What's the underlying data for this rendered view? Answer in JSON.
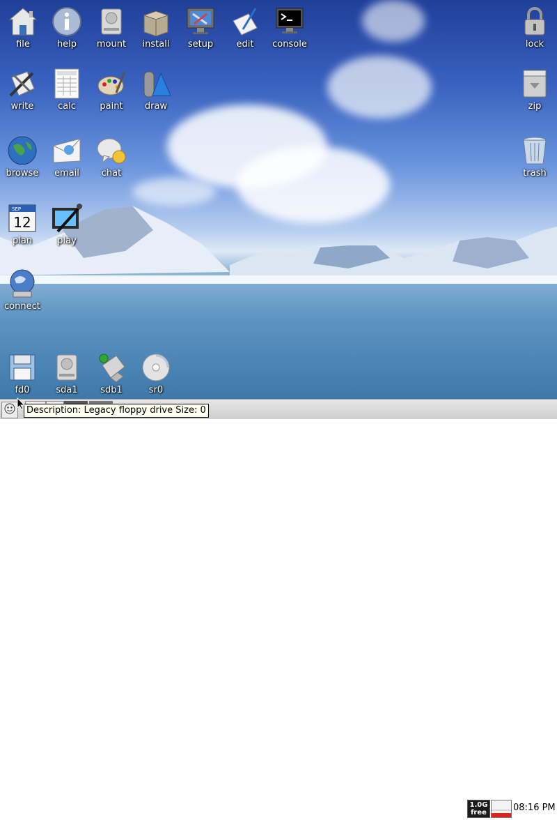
{
  "desktop_icons_left": [
    {
      "name": "file-icon",
      "label": "file"
    },
    {
      "name": "help-icon",
      "label": "help"
    },
    {
      "name": "mount-icon",
      "label": "mount"
    },
    {
      "name": "install-icon",
      "label": "install"
    },
    {
      "name": "setup-icon",
      "label": "setup"
    },
    {
      "name": "edit-icon",
      "label": "edit"
    },
    {
      "name": "console-icon",
      "label": "console"
    },
    {
      "name": "write-icon",
      "label": "write"
    },
    {
      "name": "calc-icon",
      "label": "calc"
    },
    {
      "name": "paint-icon",
      "label": "paint"
    },
    {
      "name": "draw-icon",
      "label": "draw"
    },
    {
      "name": "browse-icon",
      "label": "browse"
    },
    {
      "name": "email-icon",
      "label": "email"
    },
    {
      "name": "chat-icon",
      "label": "chat"
    },
    {
      "name": "plan-icon",
      "label": "plan",
      "calendar_month": "SEP",
      "calendar_day": "12"
    },
    {
      "name": "play-icon",
      "label": "play"
    },
    {
      "name": "connect-icon",
      "label": "connect"
    }
  ],
  "desktop_icons_right": [
    {
      "name": "lock-icon",
      "label": "lock"
    },
    {
      "name": "zip-icon",
      "label": "zip"
    },
    {
      "name": "trash-icon",
      "label": "trash"
    }
  ],
  "drives": [
    {
      "name": "floppy-drive-icon",
      "label": "fd0"
    },
    {
      "name": "hard-drive-icon",
      "label": "sda1"
    },
    {
      "name": "usb-drive-icon",
      "label": "sdb1"
    },
    {
      "name": "cdrom-drive-icon",
      "label": "sr0"
    }
  ],
  "tooltip": {
    "text": "Description: Legacy floppy drive Size: 0"
  },
  "tray": {
    "free_top": "1.0G",
    "free_bottom": "free",
    "clock": "08:16 PM"
  }
}
